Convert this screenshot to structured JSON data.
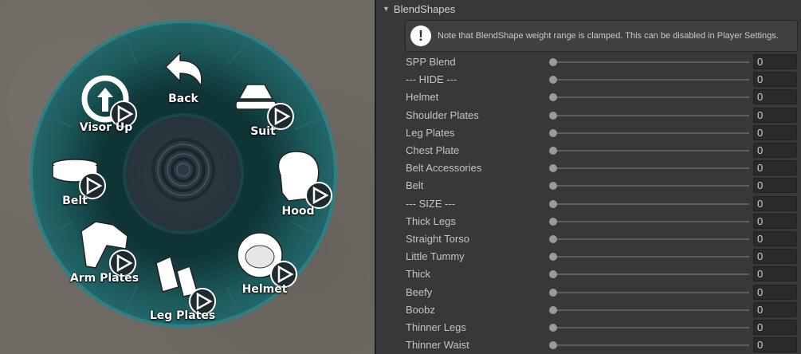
{
  "radial_menu": {
    "items": [
      {
        "label": "Back",
        "icon": "back-arrow-icon"
      },
      {
        "label": "Suit",
        "icon": "suit-icon"
      },
      {
        "label": "Hood",
        "icon": "hood-icon"
      },
      {
        "label": "Helmet",
        "icon": "helmet-icon"
      },
      {
        "label": "Leg Plates",
        "icon": "leg-plates-icon"
      },
      {
        "label": "Arm Plates",
        "icon": "arm-plates-icon"
      },
      {
        "label": "Belt",
        "icon": "belt-icon"
      },
      {
        "label": "Visor Up",
        "icon": "visor-up-icon"
      }
    ],
    "colors": {
      "ring": "#1a4d4f",
      "ring_outer": "#2f7f82",
      "center": "#2b3a40"
    }
  },
  "inspector": {
    "section_title": "BlendShapes",
    "help_text": "Note that BlendShape weight range is clamped. This can be disabled in Player Settings.",
    "help_icon": "!",
    "rows": [
      {
        "label": "SPP Blend",
        "value": "0",
        "fraction": 0
      },
      {
        "label": "--- HIDE ---",
        "value": "0",
        "fraction": 0
      },
      {
        "label": "Helmet",
        "value": "0",
        "fraction": 0
      },
      {
        "label": "Shoulder Plates",
        "value": "0",
        "fraction": 0
      },
      {
        "label": "Leg Plates",
        "value": "0",
        "fraction": 0
      },
      {
        "label": "Chest Plate",
        "value": "0",
        "fraction": 0
      },
      {
        "label": "Belt Accessories",
        "value": "0",
        "fraction": 0
      },
      {
        "label": "Belt",
        "value": "0",
        "fraction": 0
      },
      {
        "label": "--- SIZE ---",
        "value": "0",
        "fraction": 0
      },
      {
        "label": "Thick Legs",
        "value": "0",
        "fraction": 0
      },
      {
        "label": "Straight Torso",
        "value": "0",
        "fraction": 0
      },
      {
        "label": "Little Tummy",
        "value": "0",
        "fraction": 0
      },
      {
        "label": "Thick",
        "value": "0",
        "fraction": 0
      },
      {
        "label": "Beefy",
        "value": "0",
        "fraction": 0
      },
      {
        "label": "Boobz",
        "value": "0",
        "fraction": 0
      },
      {
        "label": "Thinner Legs",
        "value": "0",
        "fraction": 0
      },
      {
        "label": "Thinner Waist",
        "value": "0",
        "fraction": 0
      }
    ]
  }
}
